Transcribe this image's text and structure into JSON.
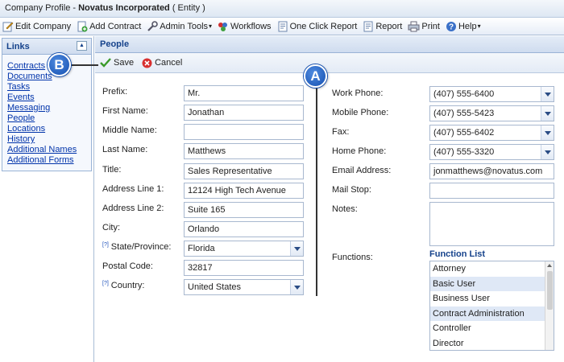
{
  "window": {
    "title_prefix": "Company Profile - ",
    "company_name": "Novatus Incorporated",
    "title_suffix": " ( Entity )"
  },
  "toolbar": {
    "items": [
      {
        "label": "Edit Company",
        "icon": "edit-icon"
      },
      {
        "label": "Add Contract",
        "icon": "add-contract-icon"
      },
      {
        "label": "Admin Tools",
        "icon": "wrench-icon",
        "dropdown": true
      },
      {
        "label": "Workflows",
        "icon": "workflow-icon"
      },
      {
        "label": "One Click Report",
        "icon": "report-icon"
      },
      {
        "label": "Report",
        "icon": "report-icon"
      },
      {
        "label": "Print",
        "icon": "printer-icon"
      },
      {
        "label": "Help",
        "icon": "help-icon",
        "dropdown": true
      }
    ],
    "caret": "▾"
  },
  "links": {
    "title": "Links",
    "collapse_glyph": "▲",
    "items": [
      "Contracts",
      "Documents",
      "Tasks",
      "Events",
      "Messaging",
      "People",
      "Locations",
      "History",
      "Additional Names",
      "Additional Forms"
    ]
  },
  "people": {
    "title": "People",
    "save_label": "Save",
    "cancel_label": "Cancel"
  },
  "form": {
    "help_marker": "[?]",
    "prefix": {
      "label": "Prefix:",
      "value": "Mr."
    },
    "first_name": {
      "label": "First Name:",
      "value": "Jonathan"
    },
    "middle_name": {
      "label": "Middle Name:",
      "value": ""
    },
    "last_name": {
      "label": "Last Name:",
      "value": "Matthews"
    },
    "title": {
      "label": "Title:",
      "value": "Sales Representative"
    },
    "address1": {
      "label": "Address Line 1:",
      "value": "12124 High Tech Avenue"
    },
    "address2": {
      "label": "Address Line 2:",
      "value": "Suite 165"
    },
    "city": {
      "label": "City:",
      "value": "Orlando"
    },
    "state": {
      "label": "State/Province:",
      "value": "Florida"
    },
    "postal": {
      "label": "Postal Code:",
      "value": "32817"
    },
    "country": {
      "label": "Country:",
      "value": "United States"
    },
    "work_phone": {
      "label": "Work Phone:",
      "value": "(407) 555-6400"
    },
    "mobile_phone": {
      "label": "Mobile Phone:",
      "value": "(407) 555-5423"
    },
    "fax": {
      "label": "Fax:",
      "value": "(407) 555-6402"
    },
    "home_phone": {
      "label": "Home Phone:",
      "value": "(407) 555-3320"
    },
    "email": {
      "label": "Email Address:",
      "value": "jonmatthews@novatus.com"
    },
    "mail_stop": {
      "label": "Mail Stop:",
      "value": ""
    },
    "notes": {
      "label": "Notes:",
      "value": ""
    },
    "functions": {
      "label": "Functions:",
      "list_title": "Function List",
      "items": [
        {
          "label": "Attorney",
          "selected": false
        },
        {
          "label": "Basic User",
          "selected": true
        },
        {
          "label": "Business User",
          "selected": false
        },
        {
          "label": "Contract Administration",
          "selected": true
        },
        {
          "label": "Controller",
          "selected": false
        },
        {
          "label": "Director",
          "selected": false
        }
      ]
    }
  },
  "callouts": {
    "a": "A",
    "b": "B"
  },
  "colors": {
    "accent": "#15428b",
    "link": "#0033aa",
    "badge": "#1a5fc8",
    "selected_row": "#dfe8f6"
  }
}
